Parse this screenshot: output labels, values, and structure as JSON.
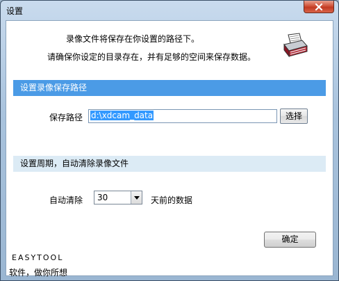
{
  "window": {
    "title": "设置",
    "close_symbol": "✕"
  },
  "info": {
    "line1": "录像文件将保存在你设置的路径下。",
    "line2": "请确保你设定的目录存在，并有足够的空间来保存数据。",
    "icon": "printer-icon"
  },
  "section_path": {
    "header": "设置录像保存路径",
    "label": "保存路径",
    "value": "d:\\xdcam_data",
    "button": "选择"
  },
  "section_clean": {
    "header": "设置周期，自动清除录像文件",
    "label": "自动清除",
    "days": "30",
    "suffix": "天前的数据"
  },
  "footer": {
    "ok": "确定",
    "brand": "EASYTOOL",
    "slogan": "软件，做你所想"
  },
  "colors": {
    "section_active": "#4b9be6",
    "section_light": "#dcebf5",
    "close_red": "#c23a22"
  }
}
